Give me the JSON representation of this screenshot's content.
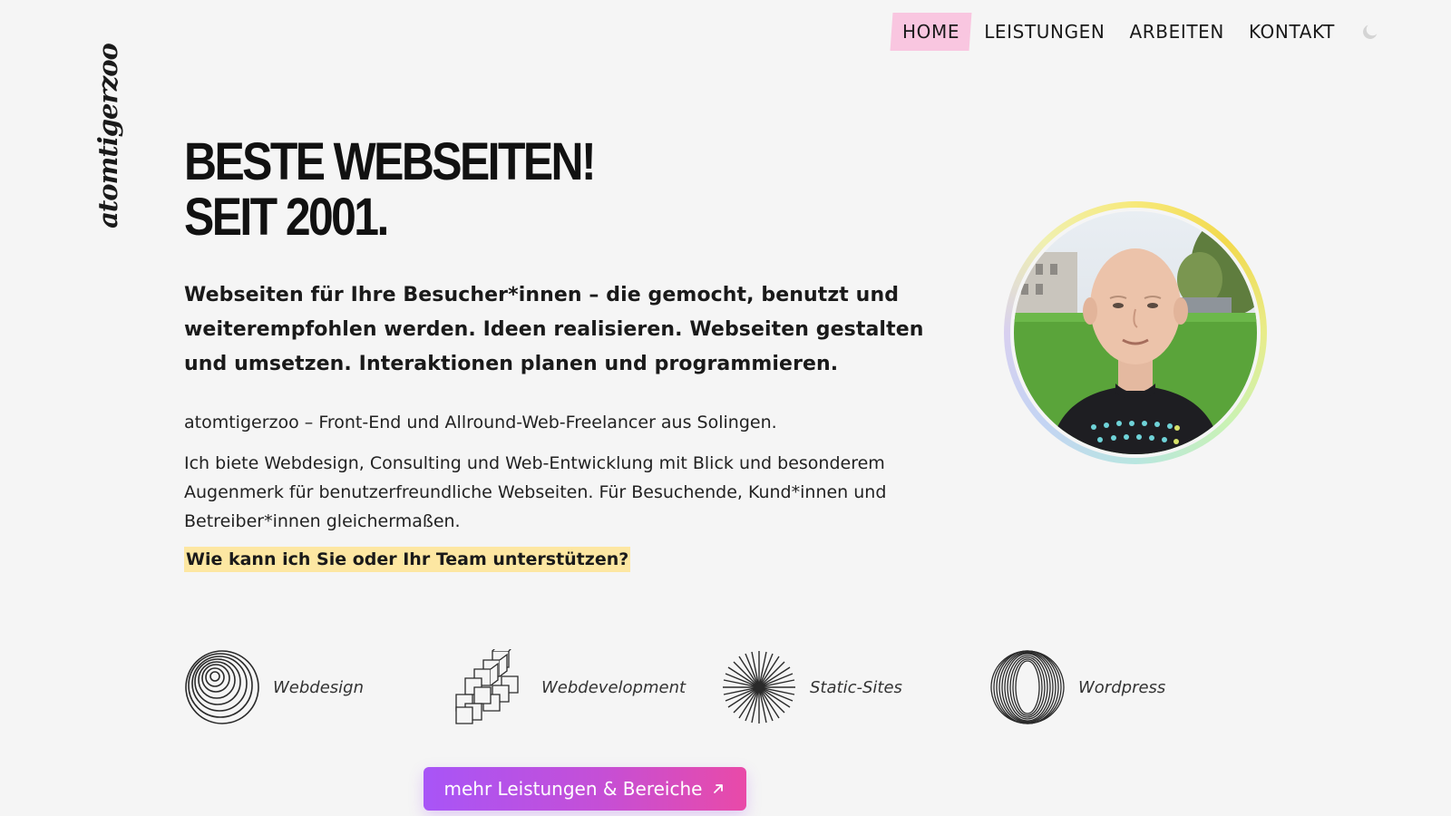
{
  "brand": {
    "logo_text": "atomtigerzoo"
  },
  "nav": {
    "items": [
      {
        "label": "HOME",
        "active": true
      },
      {
        "label": "LEISTUNGEN",
        "active": false
      },
      {
        "label": "ARBEITEN",
        "active": false
      },
      {
        "label": "KONTAKT",
        "active": false
      }
    ],
    "theme_toggle_icon": "moon-icon"
  },
  "hero": {
    "headline_line1": "BESTE WEBSEITEN!",
    "headline_line2": "SEIT 2001.",
    "lead": "Webseiten für Ihre Besucher*innen – die gemocht, benutzt und weiterempfohlen werden. Ideen realisieren. Webseiten gestalten und umsetzen. Interaktionen planen und programmieren.",
    "intro": "atomtigerzoo – Front-End und Allround-Web-Freelancer aus Solingen.",
    "description": "Ich biete Webdesign, Consulting und Web-Entwicklung mit Blick und besonderem Augenmerk für benutzerfreundliche Webseiten. Für Besuchende, Kund*innen und Betreiber*innen gleichermaßen.",
    "cta_link": "Wie kann ich Sie oder Ihr Team unterstützen?"
  },
  "portrait": {
    "icon": "portrait-photo"
  },
  "services": [
    {
      "label": "Webdesign",
      "icon": "concentric-circles-icon"
    },
    {
      "label": "Webdevelopment",
      "icon": "stacked-cubes-icon"
    },
    {
      "label": "Static-Sites",
      "icon": "starburst-icon"
    },
    {
      "label": "Wordpress",
      "icon": "ring-torus-icon"
    }
  ],
  "more_button": {
    "label": "mehr Leistungen & Bereiche",
    "icon": "arrow-up-right-icon"
  },
  "colors": {
    "background": "#f5f5f5",
    "nav_active": "#f9c6e0",
    "cta_highlight": "#fde7a2",
    "button_gradient_start": "#a855f7",
    "button_gradient_end": "#e94aa8"
  }
}
